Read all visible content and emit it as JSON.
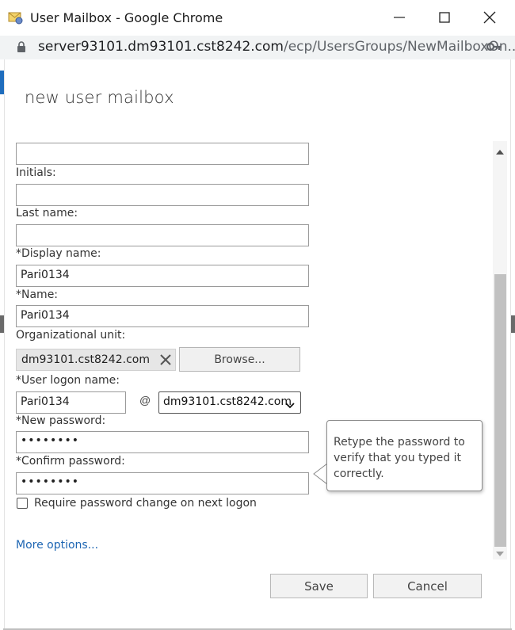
{
  "window": {
    "title": "User Mailbox - Google Chrome",
    "url_host": "server93101.dm93101.cst8242.com",
    "url_path": "/ecp/UsersGroups/NewMailboxOn..."
  },
  "dialog": {
    "title": "new user mailbox"
  },
  "form": {
    "first_name_value": "",
    "initials_label": "Initials:",
    "initials_value": "",
    "last_name_label": "Last name:",
    "last_name_value": "",
    "display_name_label": "*Display name:",
    "display_name_value": "Pari0134",
    "name_label": "*Name:",
    "name_value": "Pari0134",
    "ou_label": "Organizational unit:",
    "ou_value": "dm93101.cst8242.com",
    "browse_label": "Browse...",
    "logon_label": "*User logon name:",
    "logon_value": "Pari0134",
    "at_sign": "@",
    "domain_value": "dm93101.cst8242.com",
    "new_password_label": "*New password:",
    "new_password_value": "••••••••",
    "confirm_password_label": "*Confirm password:",
    "confirm_password_value": "••••••••",
    "require_change_label": "Require password change on next logon",
    "require_change_checked": false,
    "more_options_label": "More options..."
  },
  "tooltip": {
    "text": "Retype the password to verify that you typed it correctly."
  },
  "buttons": {
    "save_label": "Save",
    "cancel_label": "Cancel"
  },
  "colors": {
    "link": "#1e66b3",
    "accent_strip": "#1f6dbd"
  }
}
